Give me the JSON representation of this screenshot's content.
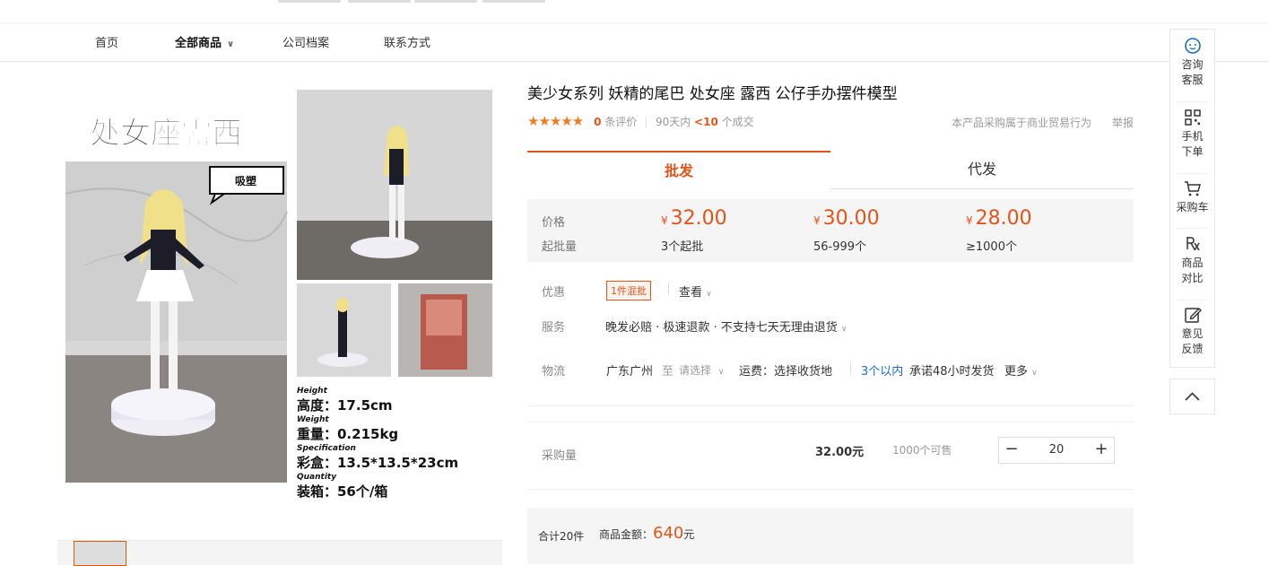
{
  "nav": {
    "items": [
      "首页",
      "全部商品",
      "公司档案",
      "联系方式"
    ]
  },
  "product": {
    "title": "美少女系列 妖精的尾巴 处女座 露西 公仔手办摆件模型",
    "stars": "★★★★★",
    "review_count": "0",
    "review_label": "条评价",
    "period": "90天内",
    "deals": "<10",
    "deals_label": "个成交",
    "trade_note": "本产品采购属于商业贸易行为",
    "report": "举报"
  },
  "image": {
    "headline": "处女座露西",
    "tag": "吸塑",
    "spec_lines": [
      {
        "small": "Height",
        "big": "高度：17.5cm"
      },
      {
        "small": "Weight",
        "big": "重量：0.215kg"
      },
      {
        "small": "Specification",
        "big": "彩盒：13.5*13.5*23cm"
      },
      {
        "small": "Quantity",
        "big": "装箱：56个/箱"
      }
    ]
  },
  "tabs": [
    "批发",
    "代发"
  ],
  "pricing": {
    "price_label": "价格",
    "moq_label": "起批量",
    "currency": "¥",
    "tiers": [
      {
        "price": "32.00",
        "moq": "3个起批"
      },
      {
        "price": "30.00",
        "moq": "56-999个"
      },
      {
        "price": "28.00",
        "moq": "≥1000个"
      }
    ]
  },
  "promo": {
    "label": "优惠",
    "badge": "1件混批",
    "link": "查看"
  },
  "service": {
    "label": "服务",
    "text": "晚发必赔 · 极速退款 · 不支持七天无理由退货"
  },
  "logistics": {
    "label": "物流",
    "origin": "广东广州",
    "to": "至",
    "select": "请选择",
    "fee": "运费：选择收货地",
    "ship_days": "3个以内",
    "promise": "承诺48小时发货",
    "more": "更多"
  },
  "purchase": {
    "label": "采购量",
    "unit_price": "32.00元",
    "stock": "1000个可售",
    "quantity": "20",
    "minus": "−",
    "plus": "+"
  },
  "total": {
    "count": "合计20件",
    "amount_label": "商品金额：",
    "amount": "640",
    "amount_unit": "元"
  },
  "sidebar": {
    "consult": [
      "咨询",
      "客服"
    ],
    "mobile": [
      "手机",
      "下单"
    ],
    "cart": "采购车",
    "compare": [
      "商品",
      "对比"
    ],
    "feedback": [
      "意见",
      "反馈"
    ]
  },
  "colors": {
    "accent": "#e2541a",
    "link": "#1a6bd1",
    "panel_bg": "#f5f5f5"
  }
}
